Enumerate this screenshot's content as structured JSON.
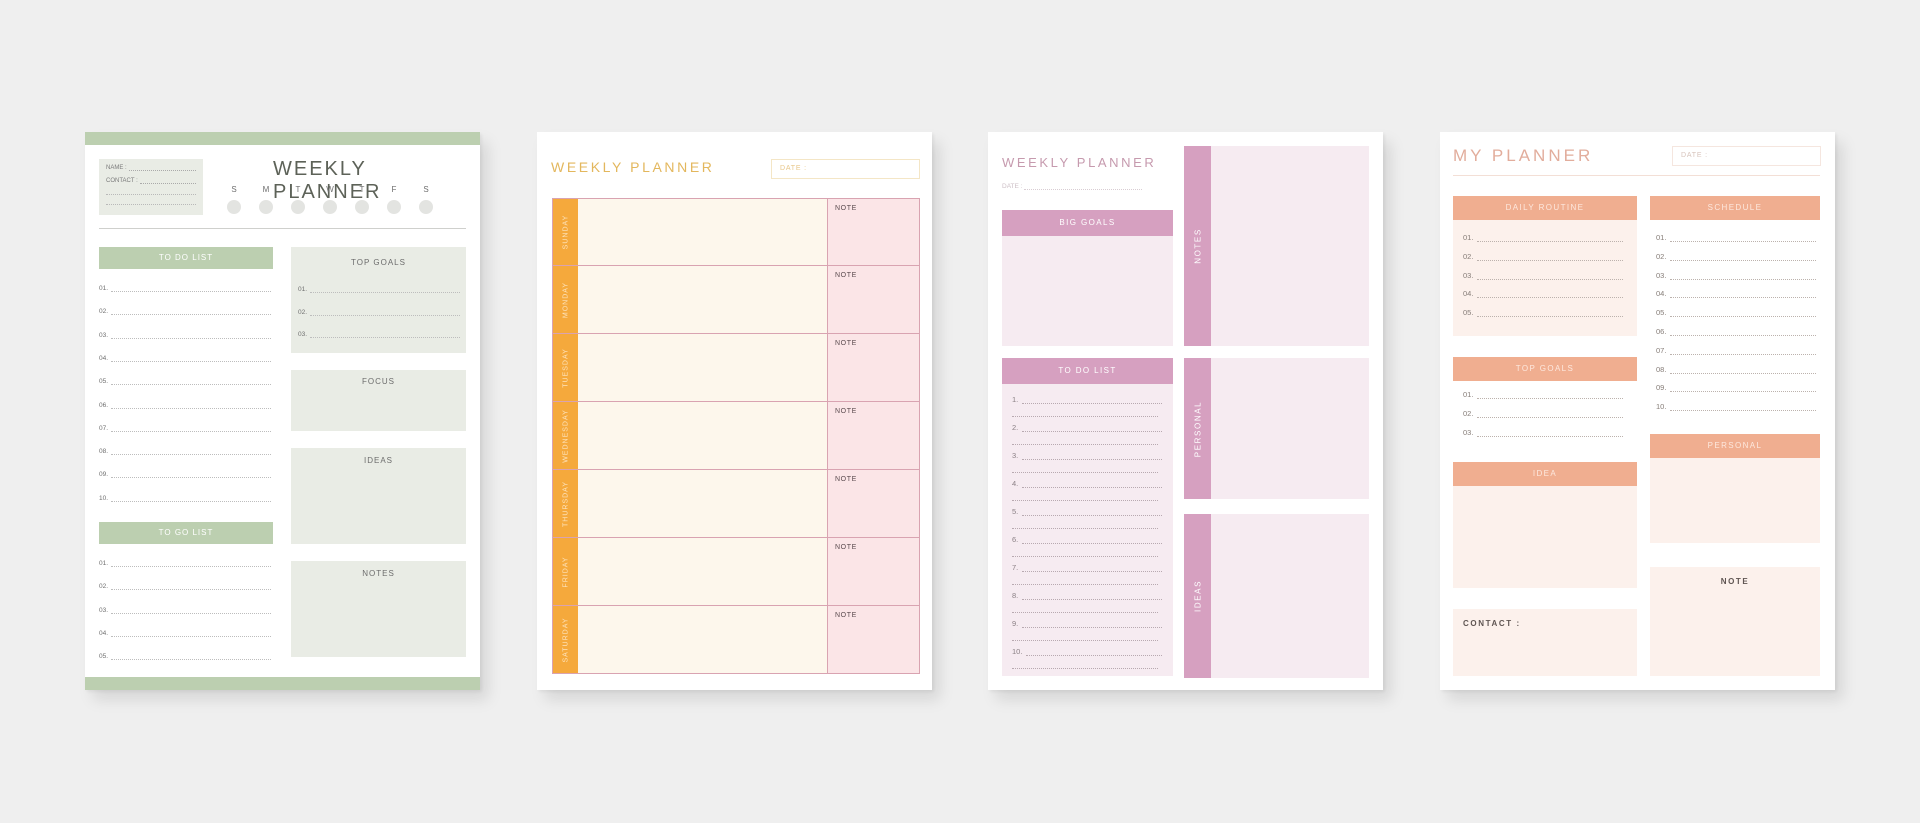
{
  "planners": {
    "green": {
      "title": "WEEKLY PLANNER",
      "name_label": "NAME :",
      "contact_label": "CONTACT :",
      "days": [
        "S",
        "M",
        "T",
        "W",
        "T",
        "F",
        "S"
      ],
      "todo_title": "TO DO LIST",
      "todo_items": [
        "01.",
        "02.",
        "03.",
        "04.",
        "05.",
        "06.",
        "07.",
        "08.",
        "09.",
        "10."
      ],
      "togo_title": "TO GO LIST",
      "togo_items": [
        "01.",
        "02.",
        "03.",
        "04.",
        "05."
      ],
      "top_goals_title": "TOP GOALS",
      "top_goals_items": [
        "01.",
        "02.",
        "03."
      ],
      "focus_title": "FOCUS",
      "ideas_title": "IDEAS",
      "notes_title": "NOTES",
      "accent": "#bccfb0"
    },
    "orange": {
      "title": "WEEKLY PLANNER",
      "date_label": "DATE :",
      "days": [
        "SUNDAY",
        "MONDAY",
        "TUESDAY",
        "WEDNESDAY",
        "THURSDAY",
        "FRIDAY",
        "SATURDAY"
      ],
      "note_label": "NOTE",
      "accent": "#f5a93c"
    },
    "pink": {
      "title": "WEEKLY PLANNER",
      "date_label": "DATE :",
      "big_goals_title": "BIG GOALS",
      "todo_title": "TO DO LIST",
      "todo_items": [
        "1.",
        "2.",
        "3.",
        "4.",
        "5.",
        "6.",
        "7.",
        "8.",
        "9.",
        "10."
      ],
      "notes_label": "NOTES",
      "personal_label": "PERSONAL",
      "ideas_label": "IDEAS",
      "accent": "#d6a0c0"
    },
    "peach": {
      "title": "MY PLANNER",
      "date_label": "DATE :",
      "daily_routine_title": "DAILY ROUTINE",
      "daily_routine_items": [
        "01.",
        "02.",
        "03.",
        "04.",
        "05."
      ],
      "schedule_title": "SCHEDULE",
      "schedule_items": [
        "01.",
        "02.",
        "03.",
        "04.",
        "05.",
        "06.",
        "07.",
        "08.",
        "09.",
        "10."
      ],
      "top_goals_title": "TOP GOALS",
      "top_goals_items": [
        "01.",
        "02.",
        "03."
      ],
      "personal_title": "PERSONAL",
      "idea_title": "IDEA",
      "note_title": "NOTE",
      "contact_label": "CONTACT :",
      "accent": "#f0ae90"
    }
  }
}
